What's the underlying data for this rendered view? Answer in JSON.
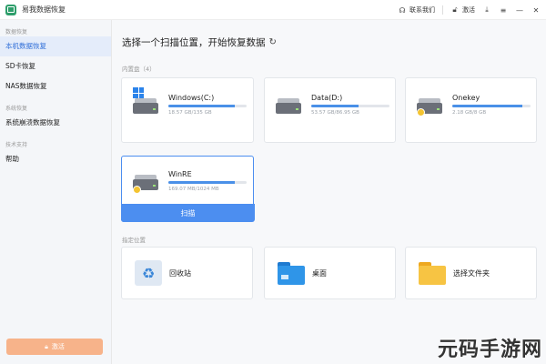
{
  "titlebar": {
    "app_title": "易我数据恢复",
    "contact_label": "联系我们",
    "activate_label": "激活"
  },
  "sidebar": {
    "group1": "数据恢复",
    "items1": [
      "本机数据恢复",
      "SD卡恢复",
      "NAS数据恢复"
    ],
    "group2": "系统恢复",
    "items2": [
      "系统崩溃数据恢复"
    ],
    "group3": "技术支持",
    "items3": [
      "帮助"
    ],
    "bottom_button": "激活"
  },
  "main": {
    "title": "选择一个扫描位置，开始恢复数据",
    "section_disks": "内置盘（4）",
    "disks": [
      {
        "name": "Windows(C:)",
        "size": "18.57 GB/135 GB",
        "used": 0.85,
        "badge": "windows"
      },
      {
        "name": "Data(D:)",
        "size": "53.57 GB/86.95 GB",
        "used": 0.6,
        "badge": "none"
      },
      {
        "name": "Onekey",
        "size": "2.18 GB/8 GB",
        "used": 0.9,
        "badge": "lock"
      },
      {
        "name": "WinRE",
        "size": "169.07 MB/1024 MB",
        "used": 0.85,
        "badge": "lock"
      }
    ],
    "scan_label": "扫描",
    "section_locations": "指定位置",
    "locations": [
      "回收站",
      "桌面",
      "选择文件夹"
    ]
  },
  "watermark": "元码手游网",
  "colors": {
    "accent": "#4c8ef0",
    "sidebar_active": "#2f6ed8",
    "activate": "#f7b38a"
  }
}
